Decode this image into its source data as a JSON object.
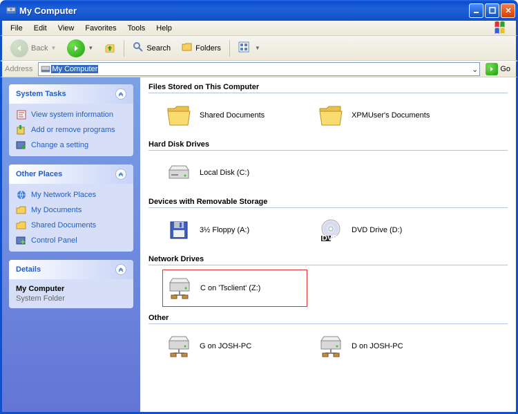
{
  "window": {
    "title": "My Computer"
  },
  "menu": {
    "file": "File",
    "edit": "Edit",
    "view": "View",
    "favorites": "Favorites",
    "tools": "Tools",
    "help": "Help"
  },
  "toolbar": {
    "back": "Back",
    "search": "Search",
    "folders": "Folders"
  },
  "address": {
    "label": "Address",
    "value": "My Computer",
    "go": "Go"
  },
  "panels": {
    "system": {
      "title": "System Tasks",
      "items": [
        {
          "label": "View system information"
        },
        {
          "label": "Add or remove programs"
        },
        {
          "label": "Change a setting"
        }
      ]
    },
    "places": {
      "title": "Other Places",
      "items": [
        {
          "label": "My Network Places"
        },
        {
          "label": "My Documents"
        },
        {
          "label": "Shared Documents"
        },
        {
          "label": "Control Panel"
        }
      ]
    },
    "details": {
      "title": "Details",
      "name": "My Computer",
      "type": "System Folder"
    }
  },
  "groups": [
    {
      "title": "Files Stored on This Computer",
      "items": [
        {
          "label": "Shared Documents",
          "icon": "folder"
        },
        {
          "label": "XPMUser's Documents",
          "icon": "folder"
        }
      ]
    },
    {
      "title": "Hard Disk Drives",
      "items": [
        {
          "label": "Local Disk (C:)",
          "icon": "hdd"
        }
      ]
    },
    {
      "title": "Devices with Removable Storage",
      "items": [
        {
          "label": "3½ Floppy (A:)",
          "icon": "floppy"
        },
        {
          "label": "DVD Drive (D:)",
          "icon": "dvd"
        }
      ]
    },
    {
      "title": "Network Drives",
      "items": [
        {
          "label": "C on 'Tsclient' (Z:)",
          "icon": "net",
          "highlight": true
        }
      ]
    },
    {
      "title": "Other",
      "items": [
        {
          "label": "G on JOSH-PC",
          "icon": "net"
        },
        {
          "label": "D on JOSH-PC",
          "icon": "net"
        }
      ]
    }
  ]
}
